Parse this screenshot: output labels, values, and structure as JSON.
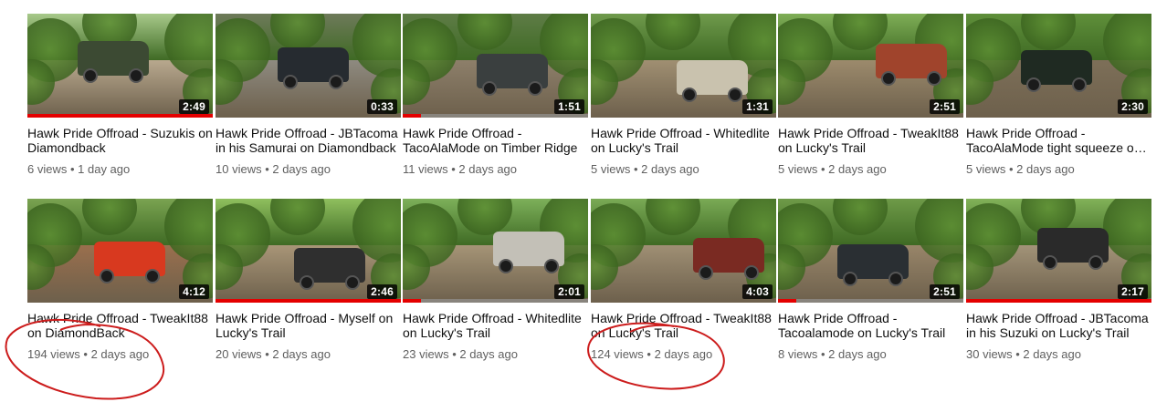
{
  "videos": [
    {
      "title": "Hawk Pride Offroad - Suzukis on Diamondback",
      "duration": "2:49",
      "views": "6 views",
      "age": "1 day ago",
      "watched": 1.0,
      "sky": "#a7c98a",
      "ground": "#b8a88e",
      "vehicle": "#3c4a33"
    },
    {
      "title": "Hawk Pride Offroad - JBTacoma in his Samurai on Diamondback",
      "duration": "0:33",
      "views": "10 views",
      "age": "2 days ago",
      "watched": 0.0,
      "sky": "#6e7a5a",
      "ground": "#8e8a80",
      "vehicle": "#262b30"
    },
    {
      "title": "Hawk Pride Offroad - TacoAlaMode on Timber Ridge",
      "duration": "1:51",
      "views": "11 views",
      "age": "2 days ago",
      "watched": 0.1,
      "sky": "#5e7c46",
      "ground": "#8d7f6a",
      "vehicle": "#3a3f3f"
    },
    {
      "title": "Hawk Pride Offroad - Whitedlite on Lucky's Trail",
      "duration": "1:31",
      "views": "5 views",
      "age": "2 days ago",
      "watched": 0.0,
      "sky": "#6f9a4c",
      "ground": "#a08f72",
      "vehicle": "#c9c2ae"
    },
    {
      "title": "Hawk Pride Offroad - TweakIt88 on Lucky's Trail",
      "duration": "2:51",
      "views": "5 views",
      "age": "2 days ago",
      "watched": 0.0,
      "sky": "#7fae57",
      "ground": "#9c8a6c",
      "vehicle": "#a0442c"
    },
    {
      "title": "Hawk Pride Offroad - TacoAlaMode tight squeeze on Lucky's Trail",
      "duration": "2:30",
      "views": "5 views",
      "age": "2 days ago",
      "watched": 0.0,
      "sky": "#5f8f3a",
      "ground": "#7d6f58",
      "vehicle": "#1f2a22"
    },
    {
      "title": "Hawk Pride Offroad - TweakIt88 on DiamondBack",
      "duration": "4:12",
      "views": "194 views",
      "age": "2 days ago",
      "watched": 0.0,
      "sky": "#7aa351",
      "ground": "#9a6f4d",
      "vehicle": "#d8391f"
    },
    {
      "title": "Hawk Pride Offroad - Myself on Lucky's Trail",
      "duration": "2:46",
      "views": "20 views",
      "age": "2 days ago",
      "watched": 1.0,
      "sky": "#8fbf5e",
      "ground": "#a89577",
      "vehicle": "#2f2f2f"
    },
    {
      "title": "Hawk Pride Offroad - Whitedlite on Lucky's Trail",
      "duration": "2:01",
      "views": "23 views",
      "age": "2 days ago",
      "watched": 0.1,
      "sky": "#7db05a",
      "ground": "#a59476",
      "vehicle": "#c3c0b7"
    },
    {
      "title": "Hawk Pride Offroad - TweakIt88 on Lucky's Trail",
      "duration": "4:03",
      "views": "124 views",
      "age": "2 days ago",
      "watched": 0.0,
      "sky": "#7aaa55",
      "ground": "#9f8f74",
      "vehicle": "#7a2a22"
    },
    {
      "title": "Hawk Pride Offroad - Tacoalamode on Lucky's Trail",
      "duration": "2:51",
      "views": "8 views",
      "age": "2 days ago",
      "watched": 0.1,
      "sky": "#6e9a48",
      "ground": "#988569",
      "vehicle": "#2a2f33"
    },
    {
      "title": "Hawk Pride Offroad - JBTacoma in his Suzuki on Lucky's Trail",
      "duration": "2:17",
      "views": "30 views",
      "age": "2 days ago",
      "watched": 1.0,
      "sky": "#82b259",
      "ground": "#a29378",
      "vehicle": "#2a2a2a"
    }
  ]
}
